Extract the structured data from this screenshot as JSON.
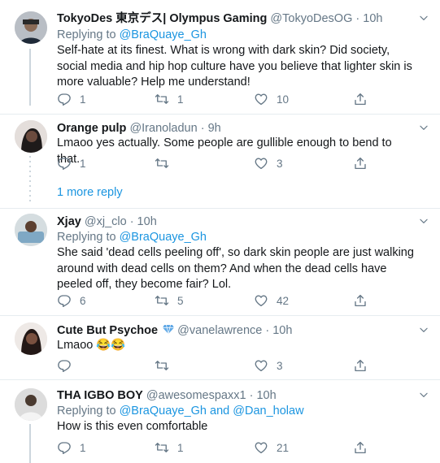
{
  "tweets": [
    {
      "name": "TokyoDes 東京デス| Olympus Gaming",
      "handle": "@TokyoDesOG",
      "time": "· 10h",
      "replying_prefix": "Replying to",
      "replying_to": "@BraQuaye_Gh",
      "text": "Self-hate at its finest.  What is wrong with dark skin? Did society, social media and hip hop culture have you believe that lighter skin is more valuable? Help me understand!",
      "replies": "1",
      "retweets": "1",
      "likes": "10"
    },
    {
      "name": "Orange pulp",
      "handle": "@Iranoladun",
      "time": "· 9h",
      "text": "Lmaoo yes actually. Some people are gullible enough to bend to that.",
      "replies": "1",
      "retweets": "",
      "likes": "3"
    },
    {
      "name": "Xjay",
      "handle": "@xj_clo",
      "time": "· 10h",
      "replying_prefix": "Replying to",
      "replying_to": "@BraQuaye_Gh",
      "text": "She said 'dead cells peeling off', so dark skin people are just walking around with dead cells on them? And when the dead cells have peeled off, they become fair? Lol.",
      "replies": "6",
      "retweets": "5",
      "likes": "42"
    },
    {
      "name": "Cute But Psychoe",
      "handle": "@vanelawrence",
      "time": "· 10h",
      "text": "Lmaoo 😂😂",
      "replies": "",
      "retweets": "",
      "likes": "3"
    },
    {
      "name": "THA IGBO BOY",
      "handle": "@awesomespaxx1",
      "time": "· 10h",
      "replying_prefix": "Replying to",
      "replying_to": "@BraQuaye_Gh",
      "replying_and": "and",
      "replying_to_2": "@Dan_holaw",
      "text": "How is this even comfortable",
      "replies": "1",
      "retweets": "1",
      "likes": "21"
    }
  ],
  "more_replies": "1 more reply",
  "verified_badge_icon": "diamond-icon",
  "colors": {
    "link": "#1b95e0",
    "muted": "#657786",
    "text": "#14171a",
    "divider": "#e6ecf0"
  }
}
